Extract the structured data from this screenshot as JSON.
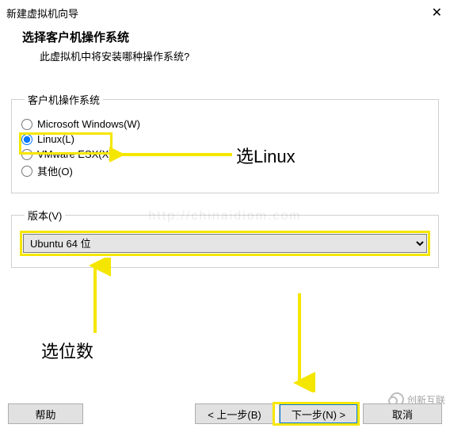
{
  "window": {
    "title": "新建虚拟机向导",
    "close_glyph": "✕"
  },
  "header": {
    "title": "选择客户机操作系统",
    "subtitle": "此虚拟机中将安装哪种操作系统?"
  },
  "os_group": {
    "legend": "客户机操作系统",
    "options": {
      "windows": "Microsoft Windows(W)",
      "linux": "Linux(L)",
      "vmware": "VMware ESX(X)",
      "other": "其他(O)"
    },
    "selected": "linux"
  },
  "version_group": {
    "legend": "版本(V)",
    "selected": "Ubuntu 64 位"
  },
  "annotations": {
    "linux": "选Linux",
    "bits": "选位数"
  },
  "footer": {
    "help": "帮助",
    "back": "< 上一步(B)",
    "next": "下一步(N) >",
    "cancel": "取消"
  },
  "watermark": {
    "brand": "创新互联",
    "ghost": "http://chinaidiom.com"
  }
}
